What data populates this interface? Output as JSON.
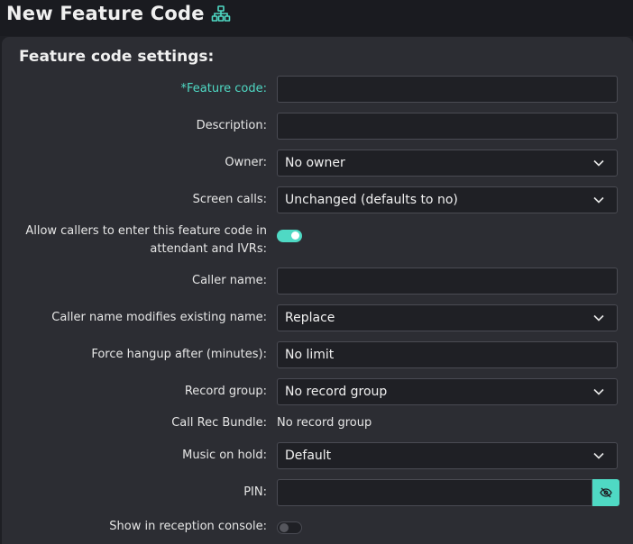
{
  "header": {
    "title": "New Feature Code",
    "title_icon": "sitemap-icon"
  },
  "section": {
    "title": "Feature code settings:"
  },
  "fields": {
    "feature_code": {
      "label": "*Feature code:",
      "value": ""
    },
    "description": {
      "label": "Description:",
      "value": ""
    },
    "owner": {
      "label": "Owner:",
      "value": "No owner"
    },
    "screen_calls": {
      "label": "Screen calls:",
      "value": "Unchanged (defaults to no)"
    },
    "allow_callers": {
      "label": "Allow callers to enter this feature code in attendant and IVRs:",
      "enabled": true
    },
    "caller_name": {
      "label": "Caller name:",
      "value": ""
    },
    "caller_name_modifies": {
      "label": "Caller name modifies existing name:",
      "value": "Replace"
    },
    "force_hangup": {
      "label": "Force hangup after (minutes):",
      "value": "No limit"
    },
    "record_group": {
      "label": "Record group:",
      "value": "No record group"
    },
    "call_rec_bundle": {
      "label": "Call Rec Bundle:",
      "value": "No record group"
    },
    "music_on_hold": {
      "label": "Music on hold:",
      "value": "Default"
    },
    "pin": {
      "label": "PIN:",
      "value": "",
      "toggle_icon": "eye-slash-icon"
    },
    "show_in_reception": {
      "label": "Show in reception console:",
      "enabled": false
    }
  },
  "colors": {
    "accent": "#4fd9c4",
    "background": "#2c2d33",
    "input_bg": "#1f2025",
    "input_border": "#4a4b53"
  }
}
